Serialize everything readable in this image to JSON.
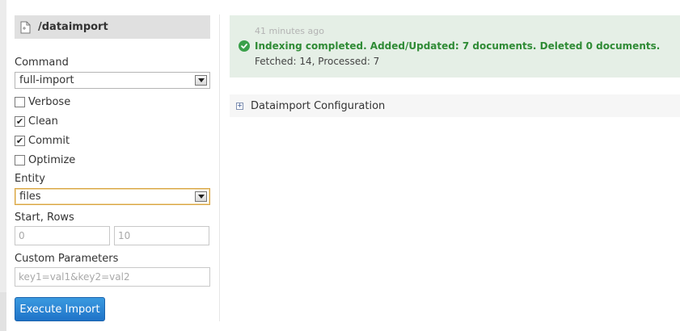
{
  "handler": {
    "title": "/dataimport",
    "icon": "document-icon"
  },
  "form": {
    "command": {
      "label": "Command",
      "value": "full-import"
    },
    "options": [
      {
        "label": "Verbose",
        "checked": false
      },
      {
        "label": "Clean",
        "checked": true
      },
      {
        "label": "Commit",
        "checked": true
      },
      {
        "label": "Optimize",
        "checked": false
      }
    ],
    "entity": {
      "label": "Entity",
      "value": "files"
    },
    "start_rows": {
      "label": "Start, Rows",
      "start_placeholder": "0",
      "rows_placeholder": "10"
    },
    "custom_params": {
      "label": "Custom Parameters",
      "placeholder": "key1=val1&key2=val2"
    },
    "execute_label": "Execute Import"
  },
  "status": {
    "time": "41 minutes ago",
    "message": "Indexing completed. Added/Updated: 7 documents. Deleted 0 documents.",
    "detail": "Fetched: 14, Processed: 7",
    "color": "#2f8b35",
    "background": "#e5efe6"
  },
  "config": {
    "label": "Dataimport Configuration",
    "expanded": false
  },
  "colors": {
    "accent": "#1f73c8",
    "success": "#3aa04a"
  }
}
